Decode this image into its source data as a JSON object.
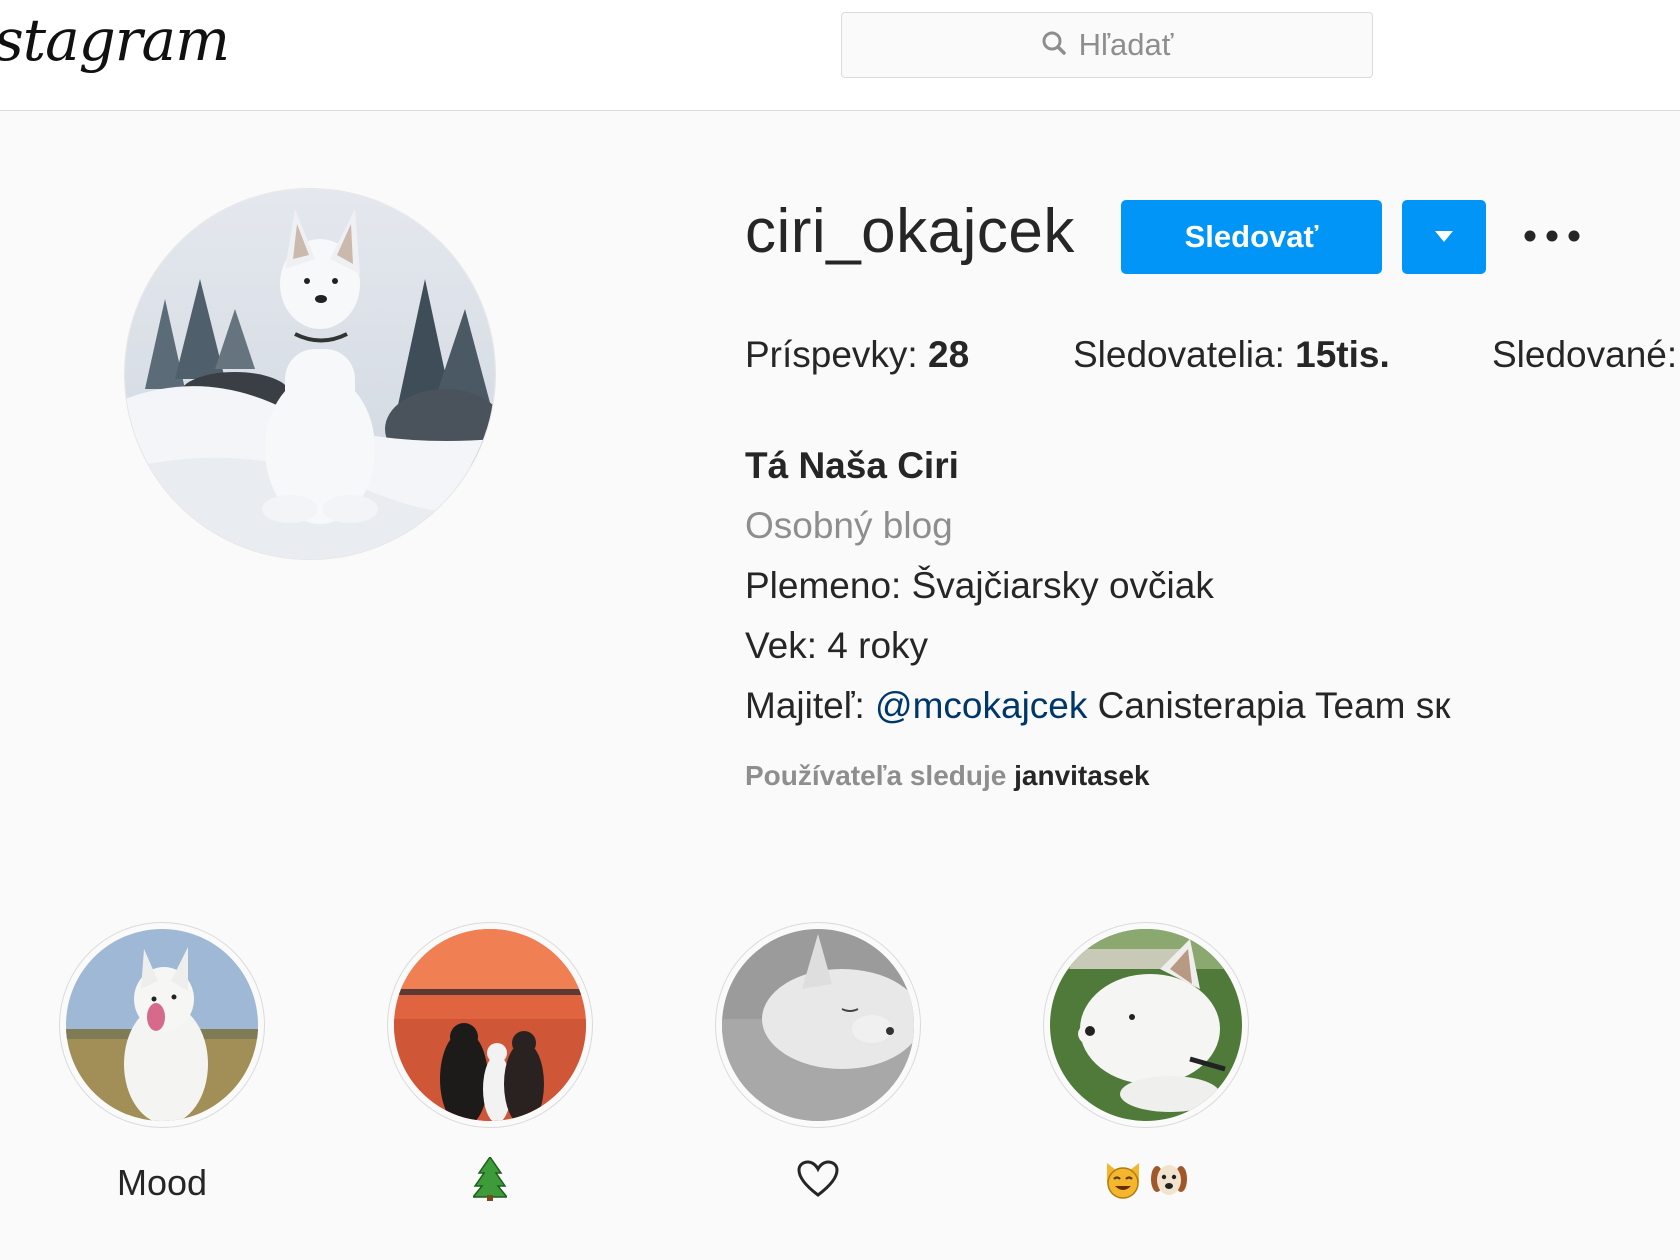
{
  "header": {
    "logo_text": "Instagram",
    "search_placeholder": "Hľadať"
  },
  "profile": {
    "username": "ciri_okajcek",
    "follow_label": "Sledovať",
    "stats": {
      "posts_label": "Príspevky:",
      "posts_value": "28",
      "followers_label": "Sledovatelia:",
      "followers_value": "15tis.",
      "following_label": "Sledované:"
    },
    "bio": {
      "name": "Tá Naša Ciri",
      "category": "Osobný blog",
      "breed": "Plemeno: Švajčiarsky ovčiak",
      "age": "Vek: 4 roky",
      "owner_prefix": "Majiteľ:",
      "owner_mention": "@mcokajcek",
      "owner_suffix": "Canisterapia Team ѕк"
    },
    "followed_by_prefix": "Používateľa sleduje",
    "followed_by_user": "janvitasek"
  },
  "highlights": [
    {
      "label": "Mood"
    },
    {
      "label": "🌲",
      "icon": "tree-icon"
    },
    {
      "label": "♡",
      "icon": "heart-icon"
    },
    {
      "label": "😺🐶",
      "icon": "cat-dog-icon"
    }
  ],
  "colors": {
    "accent": "#0095f6",
    "mention": "#00376b",
    "muted": "#8e8e8e",
    "background": "#fafafa"
  }
}
